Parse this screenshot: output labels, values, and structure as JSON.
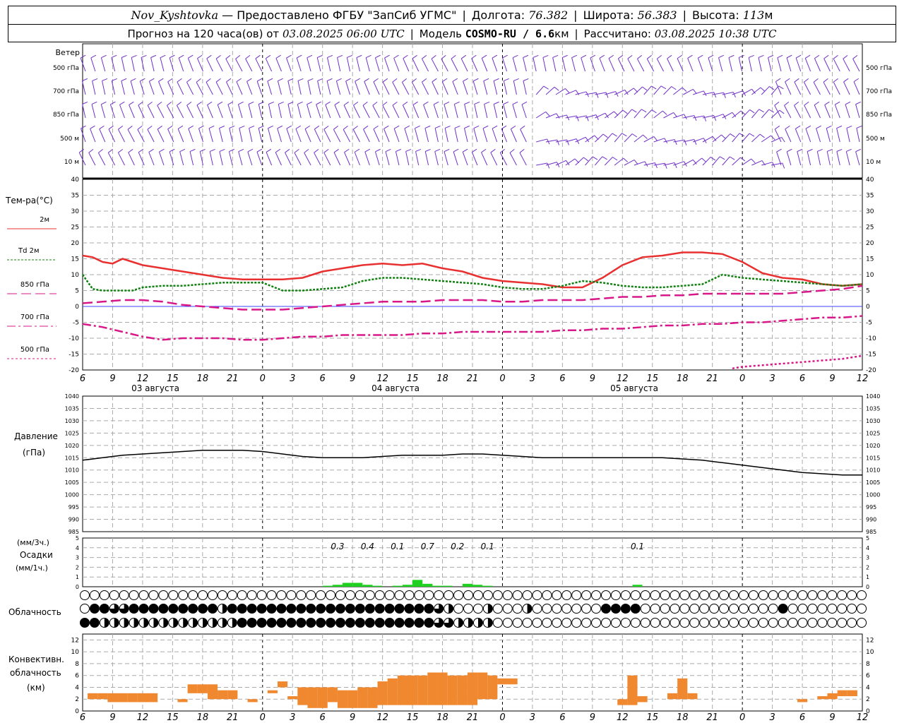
{
  "header": {
    "station": "Nov_Kyshtovka",
    "provider": "— Предоставлено ФГБУ \"ЗапСиб УГМС\"",
    "lon_label": "Долгота:",
    "lon": "76.382",
    "lat_label": "Широта:",
    "lat": "56.383",
    "alt_label": "Высота:",
    "alt": "113",
    "alt_unit": "м",
    "forecast_prefix": "Прогноз на 120 часа(ов) от",
    "forecast_time": "03.08.2025 06:00 UTC",
    "model_label": "Модель",
    "model": "COSMO-RU / 6.6",
    "model_unit": "км",
    "calc_label": "Рассчитано:",
    "calc_time": "03.08.2025 10:38 UTC"
  },
  "wind_panel": {
    "title": "Ветер",
    "levels": [
      "500 гПа",
      "700 гПа",
      "850 гПа",
      "500 м",
      "10  м"
    ],
    "color": "#7030c8"
  },
  "temp_panel": {
    "title": "Тем-ра(°C)",
    "legend": [
      {
        "label": "2м",
        "color": "#e83030",
        "style": "solid"
      },
      {
        "label": "Td 2м",
        "color": "#108010",
        "style": "dotted"
      },
      {
        "label": "850 гПа",
        "color": "#d81888",
        "style": "dashed"
      },
      {
        "label": "700 гПа",
        "color": "#d81888",
        "style": "dashdot"
      },
      {
        "label": "500 гПа",
        "color": "#d81888",
        "style": "dense"
      }
    ],
    "y_ticks": [
      "40",
      "35",
      "30",
      "25",
      "20",
      "15",
      "10",
      "5",
      "0",
      "-5",
      "-10",
      "-15",
      "-20"
    ],
    "zero_line_color": "#4040ff"
  },
  "time_axis": {
    "hour_labels": [
      "6",
      "9",
      "12",
      "15",
      "18",
      "21",
      "0",
      "3",
      "6",
      "9",
      "12",
      "15",
      "18",
      "21",
      "0",
      "3",
      "6",
      "9",
      "12",
      "15",
      "18",
      "21",
      "0",
      "3",
      "6",
      "9",
      "12"
    ],
    "day_labels": [
      "03 августа",
      "04 августа",
      "05 августа"
    ]
  },
  "pressure_panel": {
    "title": "Давление",
    "unit": "(гПа)",
    "y_ticks": [
      "1040",
      "1035",
      "1030",
      "1025",
      "1020",
      "1015",
      "1010",
      "1005",
      "1000",
      "995",
      "990",
      "985"
    ]
  },
  "precip_panel": {
    "unit_top": "(мм/3ч.)",
    "title": "Осадки",
    "unit_bottom": "(мм/1ч.)",
    "y_ticks": [
      "5",
      "4",
      "3",
      "2",
      "1",
      "0"
    ],
    "sums": [
      {
        "hour": 24,
        "text": "0.3"
      },
      {
        "hour": 27,
        "text": "0.4"
      },
      {
        "hour": 30,
        "text": "0.1"
      },
      {
        "hour": 33,
        "text": "0.7"
      },
      {
        "hour": 36,
        "text": "0.2"
      },
      {
        "hour": 39,
        "text": "0.1"
      },
      {
        "hour": 54,
        "text": "0.1"
      }
    ],
    "color": "#20d020"
  },
  "cloud_panel": {
    "title": "Облачность"
  },
  "conv_panel": {
    "title_1": "Конвективн.",
    "title_2": "облачность",
    "unit": "(км)",
    "y_ticks": [
      "12",
      "10",
      "8",
      "6",
      "4",
      "2",
      "0"
    ],
    "color": "#f08830"
  },
  "chart_data": {
    "type": "line",
    "x_unit": "hours since 03.08.2025 06:00 UTC",
    "x_range": [
      0,
      78
    ],
    "series": [
      {
        "name": "2м",
        "x": [
          0,
          1,
          2,
          3,
          4,
          5,
          6,
          8,
          10,
          12,
          14,
          16,
          18,
          20,
          22,
          24,
          26,
          28,
          30,
          32,
          34,
          36,
          38,
          40,
          42,
          44,
          46,
          48,
          50,
          52,
          54,
          56,
          58,
          60,
          62,
          64,
          66,
          68,
          70,
          72,
          74,
          76,
          78
        ],
        "y": [
          16,
          15.5,
          14,
          13.5,
          15,
          14,
          13,
          12,
          11,
          10,
          9,
          8.5,
          8.5,
          8.5,
          9,
          11,
          12,
          13,
          13.5,
          13,
          13.5,
          12,
          11,
          9,
          8,
          7.5,
          7,
          6,
          6,
          9,
          13,
          15.5,
          16,
          17,
          17,
          16.5,
          14,
          10.5,
          9,
          8.5,
          7,
          6.5,
          7
        ]
      },
      {
        "name": "Td 2м",
        "x": [
          0,
          1,
          2,
          3,
          4,
          5,
          6,
          8,
          10,
          12,
          14,
          16,
          18,
          20,
          22,
          24,
          26,
          28,
          30,
          32,
          34,
          36,
          38,
          40,
          42,
          44,
          46,
          48,
          50,
          52,
          54,
          56,
          58,
          60,
          62,
          64,
          66,
          68,
          70,
          72,
          74,
          76,
          78
        ],
        "y": [
          10,
          5.5,
          5,
          5,
          5,
          5,
          6,
          6.5,
          6.5,
          7,
          7.5,
          7.5,
          7.5,
          5,
          5,
          5.5,
          6,
          8,
          9,
          9,
          8.5,
          8,
          7.5,
          7,
          6,
          5.5,
          5.5,
          6.5,
          8,
          7.5,
          6.5,
          6,
          6,
          6.5,
          7,
          10,
          9,
          8.5,
          8,
          7.5,
          7,
          6.5,
          7
        ]
      },
      {
        "name": "850 гПа",
        "x": [
          0,
          2,
          4,
          6,
          8,
          10,
          12,
          14,
          16,
          18,
          20,
          22,
          24,
          26,
          28,
          30,
          32,
          34,
          36,
          38,
          40,
          42,
          44,
          46,
          48,
          50,
          52,
          54,
          56,
          58,
          60,
          62,
          64,
          66,
          68,
          70,
          72,
          74,
          76,
          78
        ],
        "y": [
          1,
          1.5,
          2,
          2,
          1.5,
          0.5,
          0,
          -0.5,
          -1,
          -1,
          -1,
          -0.5,
          0,
          0.5,
          1,
          1.5,
          1.5,
          1.5,
          2,
          2,
          2,
          1.5,
          1.5,
          2,
          2,
          2,
          2.5,
          3,
          3,
          3.5,
          3.5,
          4,
          4,
          4,
          4,
          4,
          4.5,
          5,
          5.5,
          6.5
        ]
      },
      {
        "name": "700 гПа",
        "x": [
          0,
          2,
          4,
          6,
          8,
          10,
          12,
          14,
          16,
          18,
          20,
          22,
          24,
          26,
          28,
          30,
          32,
          34,
          36,
          38,
          40,
          42,
          44,
          46,
          48,
          50,
          52,
          54,
          56,
          58,
          60,
          62,
          64,
          66,
          68,
          70,
          72,
          74,
          76,
          78
        ],
        "y": [
          -5.5,
          -6.5,
          -8,
          -9.5,
          -10.5,
          -10,
          -10,
          -10,
          -10.5,
          -10.5,
          -10,
          -9.5,
          -9.5,
          -9,
          -9,
          -9,
          -9,
          -8.5,
          -8.5,
          -8,
          -8,
          -8,
          -8,
          -8,
          -7.5,
          -7.5,
          -7,
          -7,
          -6.5,
          -6,
          -6,
          -5.5,
          -5.5,
          -5,
          -5,
          -4.5,
          -4,
          -3.5,
          -3.5,
          -3
        ]
      },
      {
        "name": "500 гПа",
        "x": [
          65,
          66,
          68,
          70,
          72,
          74,
          76,
          78
        ],
        "y": [
          -19.5,
          -19,
          -18.5,
          -18,
          -17.5,
          -17,
          -16.5,
          -15.5
        ]
      },
      {
        "name": "Давление",
        "x": [
          0,
          2,
          4,
          6,
          8,
          10,
          12,
          14,
          16,
          18,
          20,
          22,
          24,
          26,
          28,
          30,
          32,
          34,
          36,
          38,
          40,
          42,
          44,
          46,
          48,
          50,
          52,
          54,
          56,
          58,
          60,
          62,
          64,
          66,
          68,
          70,
          72,
          74,
          76,
          78
        ],
        "y": [
          1014,
          1015,
          1016,
          1016.5,
          1017,
          1017.5,
          1018,
          1018,
          1018,
          1017.5,
          1016.5,
          1015.5,
          1015,
          1015,
          1015,
          1015.5,
          1016,
          1016,
          1016,
          1016.5,
          1016.5,
          1016,
          1015.5,
          1015,
          1015,
          1015,
          1015,
          1015,
          1015,
          1015,
          1014.5,
          1014,
          1013,
          1012,
          1011,
          1010,
          1009,
          1008.5,
          1008,
          1008
        ]
      }
    ],
    "precip_hourly": {
      "x": [
        16,
        17,
        18,
        19,
        20,
        21,
        22,
        23,
        24,
        25,
        26,
        27,
        28,
        29,
        30,
        31,
        32,
        33,
        34,
        35,
        36,
        37,
        38,
        39,
        40,
        41,
        42,
        43,
        44,
        45,
        46,
        47,
        48,
        49,
        50,
        51,
        52,
        53,
        54,
        55,
        56
      ],
      "y": [
        0,
        0,
        0,
        0,
        0,
        0,
        0,
        0,
        0.1,
        0.2,
        0.4,
        0.4,
        0.2,
        0.1,
        0,
        0.1,
        0.2,
        0.7,
        0.3,
        0.1,
        0.1,
        0,
        0.3,
        0.2,
        0.1,
        0,
        0,
        0,
        0,
        0,
        0,
        0,
        0,
        0,
        0,
        0,
        0,
        0,
        0,
        0.2,
        0
      ]
    },
    "convective_bars": [
      {
        "x": 1,
        "base": 2,
        "top": 3
      },
      {
        "x": 2,
        "base": 2,
        "top": 3
      },
      {
        "x": 3,
        "base": 1.5,
        "top": 3
      },
      {
        "x": 4,
        "base": 1.5,
        "top": 3
      },
      {
        "x": 5,
        "base": 1.5,
        "top": 3
      },
      {
        "x": 6,
        "base": 1.5,
        "top": 3
      },
      {
        "x": 7,
        "base": 1.5,
        "top": 3
      },
      {
        "x": 10,
        "base": 1.5,
        "top": 2
      },
      {
        "x": 11,
        "base": 3,
        "top": 4.5
      },
      {
        "x": 12,
        "base": 3,
        "top": 4.5
      },
      {
        "x": 13,
        "base": 2,
        "top": 4.5
      },
      {
        "x": 14,
        "base": 2,
        "top": 3.5
      },
      {
        "x": 15,
        "base": 2,
        "top": 3.5
      },
      {
        "x": 17,
        "base": 1.5,
        "top": 2
      },
      {
        "x": 19,
        "base": 3,
        "top": 3.5
      },
      {
        "x": 20,
        "base": 4,
        "top": 5
      },
      {
        "x": 21,
        "base": 2,
        "top": 2.5
      },
      {
        "x": 22,
        "base": 1,
        "top": 4
      },
      {
        "x": 23,
        "base": 0.5,
        "top": 4
      },
      {
        "x": 24,
        "base": 0.5,
        "top": 4
      },
      {
        "x": 25,
        "base": 1.5,
        "top": 4
      },
      {
        "x": 26,
        "base": 0.5,
        "top": 3.5
      },
      {
        "x": 27,
        "base": 0.5,
        "top": 3.5
      },
      {
        "x": 28,
        "base": 0.5,
        "top": 4
      },
      {
        "x": 29,
        "base": 0.5,
        "top": 4
      },
      {
        "x": 30,
        "base": 1,
        "top": 5
      },
      {
        "x": 31,
        "base": 1,
        "top": 5.5
      },
      {
        "x": 32,
        "base": 1,
        "top": 6
      },
      {
        "x": 33,
        "base": 1,
        "top": 6
      },
      {
        "x": 34,
        "base": 1,
        "top": 6
      },
      {
        "x": 35,
        "base": 1,
        "top": 6.5
      },
      {
        "x": 36,
        "base": 1,
        "top": 6.5
      },
      {
        "x": 37,
        "base": 1,
        "top": 6
      },
      {
        "x": 38,
        "base": 1,
        "top": 6
      },
      {
        "x": 39,
        "base": 1,
        "top": 6.5
      },
      {
        "x": 40,
        "base": 2,
        "top": 6.5
      },
      {
        "x": 41,
        "base": 2,
        "top": 6
      },
      {
        "x": 42,
        "base": 4.5,
        "top": 5.5
      },
      {
        "x": 43,
        "base": 4.5,
        "top": 5.5
      },
      {
        "x": 54,
        "base": 1,
        "top": 2
      },
      {
        "x": 55,
        "base": 1,
        "top": 6
      },
      {
        "x": 56,
        "base": 1.5,
        "top": 2.5
      },
      {
        "x": 59,
        "base": 2,
        "top": 3
      },
      {
        "x": 60,
        "base": 2,
        "top": 5.5
      },
      {
        "x": 61,
        "base": 2,
        "top": 3
      },
      {
        "x": 72,
        "base": 1.5,
        "top": 2
      },
      {
        "x": 74,
        "base": 2,
        "top": 2.5
      },
      {
        "x": 75,
        "base": 2,
        "top": 3
      },
      {
        "x": 76,
        "base": 2.5,
        "top": 3.5
      },
      {
        "x": 77,
        "base": 2.5,
        "top": 3.5
      }
    ],
    "cloud_cover": {
      "columns": 80,
      "upper": [
        0,
        0,
        0,
        0,
        0,
        0,
        0,
        0,
        0,
        0,
        0,
        0,
        0,
        0,
        0,
        0,
        0,
        0,
        0,
        0,
        0,
        0,
        0,
        0,
        0,
        0,
        0,
        0,
        0,
        0,
        0,
        0,
        0,
        0,
        0,
        0,
        0,
        0,
        0,
        0,
        0,
        0,
        0,
        0,
        0,
        0,
        0,
        0,
        0,
        0,
        0,
        0,
        0,
        0,
        0,
        0,
        0,
        0,
        0,
        0,
        0,
        0,
        0,
        0,
        0,
        0,
        0,
        0,
        0,
        0,
        0,
        0,
        0,
        0,
        0,
        0,
        0,
        0,
        0,
        0
      ],
      "middle": [
        0,
        4,
        4,
        3,
        3,
        4,
        4,
        4,
        4,
        4,
        4,
        4,
        4,
        4,
        2,
        4,
        4,
        4,
        4,
        4,
        4,
        4,
        4,
        4,
        4,
        4,
        4,
        4,
        4,
        4,
        4,
        4,
        4,
        4,
        4,
        4,
        3,
        2,
        0,
        0,
        0,
        2,
        0,
        0,
        0,
        2,
        0,
        0,
        0,
        0,
        0,
        0,
        0,
        4,
        4,
        4,
        4,
        0,
        0,
        0,
        0,
        0,
        0,
        0,
        0,
        0,
        0,
        0,
        0,
        0,
        0,
        4,
        0,
        0,
        0,
        0,
        0,
        0,
        0,
        0
      ],
      "lower": [
        4,
        4,
        2,
        2,
        2,
        2,
        2,
        2,
        2,
        2,
        2,
        2,
        2,
        2,
        2,
        2,
        4,
        4,
        4,
        4,
        4,
        4,
        4,
        4,
        4,
        4,
        4,
        4,
        4,
        4,
        4,
        4,
        4,
        4,
        4,
        4,
        3,
        3,
        2,
        2,
        2,
        2,
        0,
        0,
        0,
        0,
        0,
        0,
        0,
        0,
        0,
        0,
        0,
        0,
        0,
        0,
        0,
        0,
        0,
        0,
        0,
        0,
        0,
        0,
        0,
        0,
        0,
        0,
        0,
        0,
        0,
        0,
        0,
        0,
        0,
        0,
        0,
        0,
        0,
        0
      ]
    }
  }
}
